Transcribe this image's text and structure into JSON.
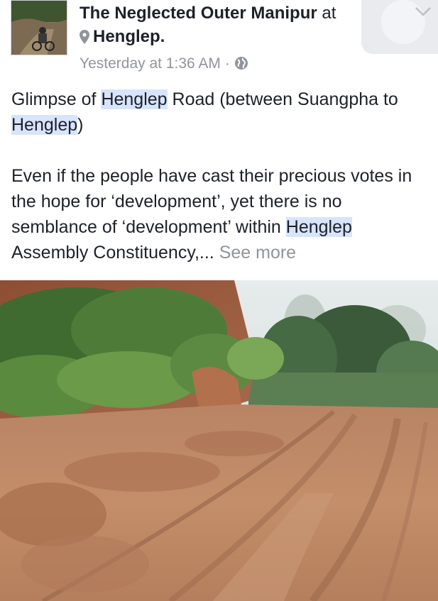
{
  "post": {
    "page_name": "The Neglected Outer Manipur",
    "at_word": "at",
    "location": "Henglep.",
    "timestamp": "Yesterday at 1:36 AM",
    "dot": "·",
    "privacy_icon": "globe-icon",
    "location_icon": "map-pin-icon",
    "menu_icon": "chevron-down-icon"
  },
  "text": {
    "p1_a": "Glimpse of ",
    "p1_hl1": "Henglep",
    "p1_b": " Road (between Suangpha to ",
    "p1_hl2": "Henglep",
    "p1_c": ")",
    "p2_a": "Even if the people have cast their precious votes in the hope for ‘development’, yet there is no semblance of ‘development’ within ",
    "p2_hl": "Henglep",
    "p2_b": " Assembly Constituency,... ",
    "see_more": "See more"
  },
  "colors": {
    "text": "#1d2129",
    "secondary": "#90949c",
    "highlight": "#d8e4fc"
  }
}
